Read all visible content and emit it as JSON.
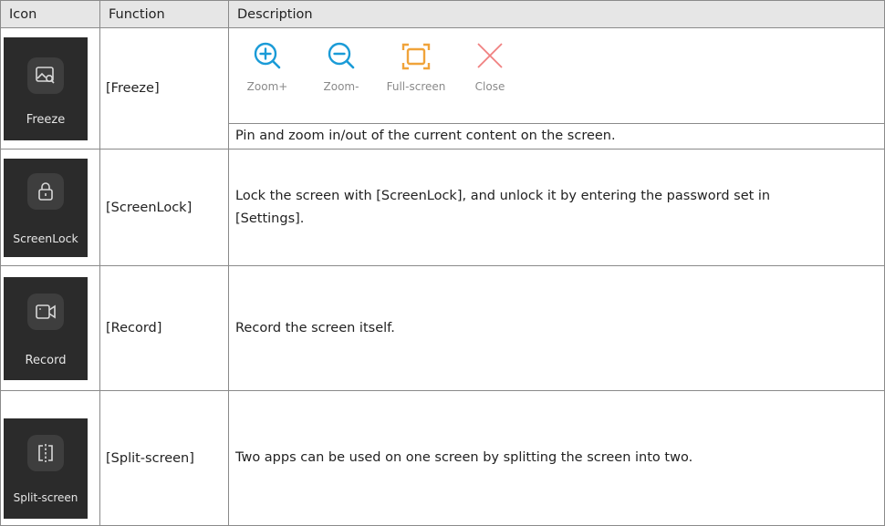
{
  "table": {
    "headers": {
      "icon": "Icon",
      "function": "Function",
      "description": "Description"
    },
    "rows": [
      {
        "icon_name": "freeze-icon",
        "icon_label": "Freeze",
        "function": "[Freeze]",
        "tools": [
          {
            "icon": "zoom-in-icon",
            "label": "Zoom+",
            "color": "#1a9bd7"
          },
          {
            "icon": "zoom-out-icon",
            "label": "Zoom-",
            "color": "#1a9bd7"
          },
          {
            "icon": "full-screen-icon",
            "label": "Full-screen",
            "color": "#f0a33a"
          },
          {
            "icon": "close-icon",
            "label": "Close",
            "color": "#f08080"
          }
        ],
        "description": "Pin and zoom in/out of the current content on the screen."
      },
      {
        "icon_name": "lock-icon",
        "icon_label": "ScreenLock",
        "function": "[ScreenLock]",
        "description": "Lock the screen with [ScreenLock], and unlock it by entering the password set in [Settings]."
      },
      {
        "icon_name": "video-camera-icon",
        "icon_label": "Record",
        "function": "[Record]",
        "description": "Record the screen itself."
      },
      {
        "icon_name": "split-screen-icon",
        "icon_label": "Split-screen",
        "function": "[Split-screen]",
        "description": "Two apps can be used on one screen by splitting the screen into two."
      }
    ]
  },
  "colors": {
    "header_bg": "#e6e6e6",
    "border": "#8a8a8a",
    "tile_bg": "#2b2b2b",
    "zoom_blue": "#1a9bd7",
    "fullscreen_orange": "#f0a33a",
    "close_pink": "#f08080"
  }
}
